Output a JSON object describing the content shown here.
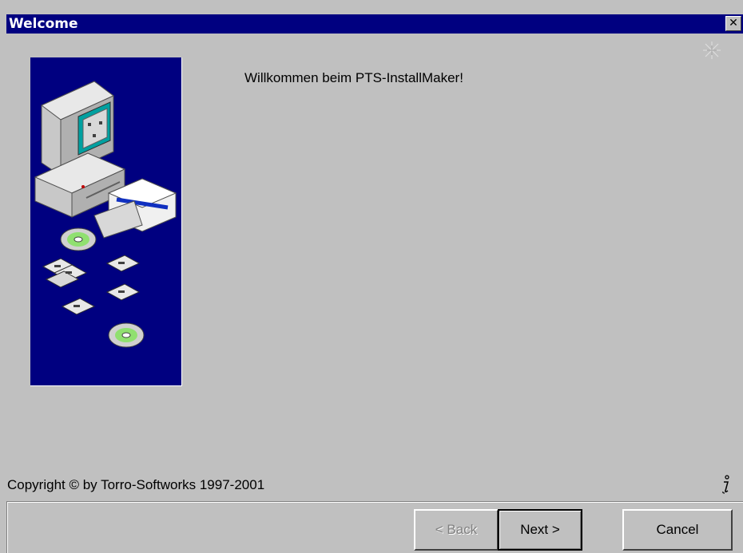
{
  "window": {
    "title": "Welcome",
    "close_label": "✕"
  },
  "main": {
    "welcome_text": "Willkommen beim PTS-InstallMaker!",
    "copyright_text": "Copyright © by Torro-Softworks 1997-2001"
  },
  "icons": {
    "side_image": "installer-illustration",
    "sparkle": "sparkle-icon",
    "info": "info-icon"
  },
  "buttons": {
    "back_label": "< Back",
    "next_label": "Next >",
    "cancel_label": "Cancel",
    "back_enabled": false
  },
  "colors": {
    "titlebar": "#000080",
    "background": "#c0c0c0",
    "side_panel": "#000080"
  }
}
